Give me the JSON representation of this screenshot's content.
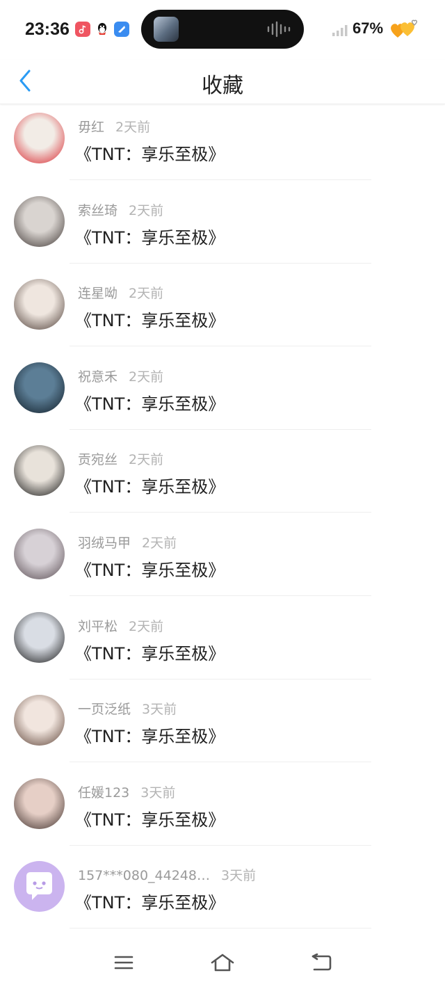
{
  "status_bar": {
    "time": "23:36",
    "battery": "67%",
    "icons": [
      "music-app-icon",
      "qq-icon",
      "mail-app-icon",
      "signal-icon",
      "hearts-icon"
    ]
  },
  "header": {
    "title": "收藏",
    "back_icon": "chevron-left-icon"
  },
  "items": [
    {
      "name": "毋红",
      "time": "2天前",
      "content": "《TNT：享乐至极》",
      "avatar_colors": [
        "#f2ece6",
        "#d8222a"
      ]
    },
    {
      "name": "索丝琦",
      "time": "2天前",
      "content": "《TNT：享乐至极》",
      "avatar_colors": [
        "#d9d4d0",
        "#3b3330"
      ]
    },
    {
      "name": "连星呦",
      "time": "2天前",
      "content": "《TNT：享乐至极》",
      "avatar_colors": [
        "#efe6df",
        "#4a3a33"
      ]
    },
    {
      "name": "祝意禾",
      "time": "2天前",
      "content": "《TNT：享乐至极》",
      "avatar_colors": [
        "#5c7e96",
        "#0e1a24"
      ]
    },
    {
      "name": "贡宛丝",
      "time": "2天前",
      "content": "《TNT：享乐至极》",
      "avatar_colors": [
        "#e8e2da",
        "#111111"
      ]
    },
    {
      "name": "羽绒马甲",
      "time": "2天前",
      "content": "《TNT：享乐至极》",
      "avatar_colors": [
        "#d7d1d6",
        "#56494f"
      ]
    },
    {
      "name": "刘平松",
      "time": "2天前",
      "content": "《TNT：享乐至极》",
      "avatar_colors": [
        "#d9dde4",
        "#121212"
      ]
    },
    {
      "name": "一页泛纸",
      "time": "3天前",
      "content": "《TNT：享乐至极》",
      "avatar_colors": [
        "#f1e5de",
        "#5b4034"
      ]
    },
    {
      "name": "任媛123",
      "time": "3天前",
      "content": "《TNT：享乐至极》",
      "avatar_colors": [
        "#e6cfc6",
        "#3a2b27"
      ]
    },
    {
      "name": "157***080_44248…",
      "time": "3天前",
      "content": "《TNT：享乐至极》",
      "avatar_colors": [
        "#cbb4ef",
        "#ffffff"
      ]
    }
  ],
  "system_nav": {
    "menu_icon": "menu-icon",
    "home_icon": "home-icon",
    "back_icon": "back-arrow-icon"
  }
}
